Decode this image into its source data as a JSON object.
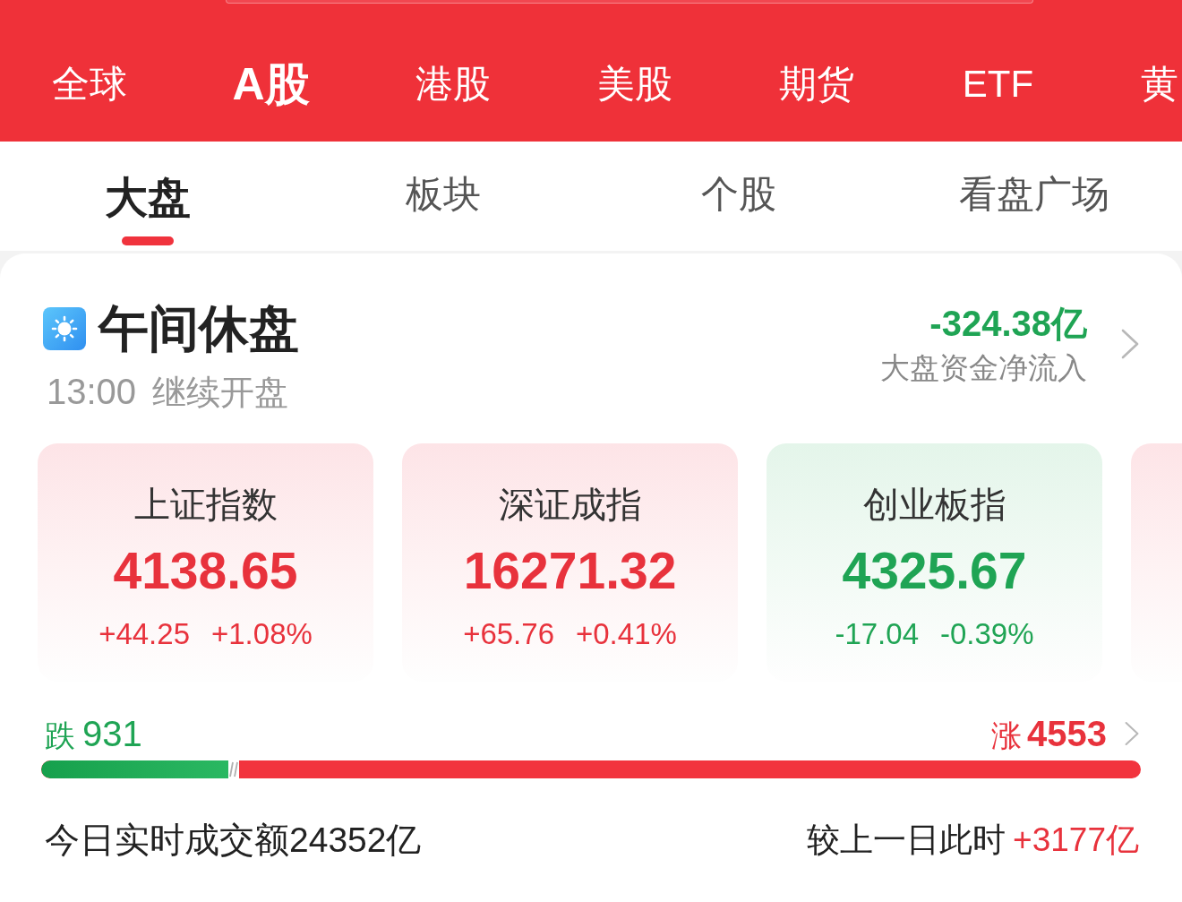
{
  "market_tabs": [
    {
      "label": "全球",
      "selected": false
    },
    {
      "label": "A股",
      "selected": true
    },
    {
      "label": "港股",
      "selected": false
    },
    {
      "label": "美股",
      "selected": false
    },
    {
      "label": "期货",
      "selected": false
    },
    {
      "label": "ETF",
      "selected": false
    },
    {
      "label": "黄",
      "selected": false
    }
  ],
  "view_tabs": [
    {
      "label": "大盘",
      "selected": true
    },
    {
      "label": "板块",
      "selected": false
    },
    {
      "label": "个股",
      "selected": false
    },
    {
      "label": "看盘广场",
      "selected": false
    }
  ],
  "session": {
    "status": "午间休盘",
    "resume_time": "13:00",
    "resume_label": "继续开盘",
    "net_flow": "-324.38亿",
    "net_flow_rising": false,
    "net_flow_label": "大盘资金净流入"
  },
  "indices": [
    {
      "name": "上证指数",
      "value": "4138.65",
      "change": "+44.25",
      "change_pct": "+1.08%",
      "rising": true
    },
    {
      "name": "深证成指",
      "value": "16271.32",
      "change": "+65.76",
      "change_pct": "+0.41%",
      "rising": true
    },
    {
      "name": "创业板指",
      "value": "4325.67",
      "change": "-17.04",
      "change_pct": "-0.39%",
      "rising": false
    },
    {
      "rising": true
    }
  ],
  "breadth": {
    "fall_label": "跌",
    "fall_count": "931",
    "rise_label": "涨",
    "rise_count": "4553",
    "level": 0.17
  },
  "turnover": {
    "text": "今日实时成交额24352亿",
    "compare_label": "较上一日此时",
    "compare_value": "+3177亿",
    "compare_rising": true
  }
}
